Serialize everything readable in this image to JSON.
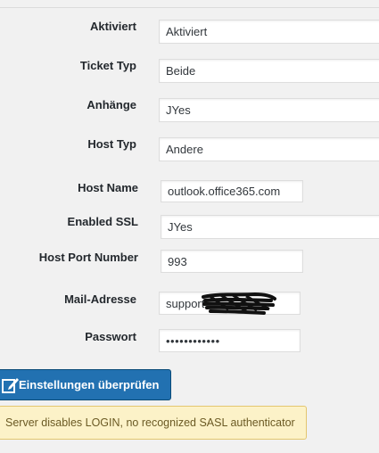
{
  "form": {
    "rows": [
      {
        "label": "Aktiviert",
        "value": "Aktiviert"
      },
      {
        "label": "Ticket Typ",
        "value": "Beide"
      },
      {
        "label": "Anhänge",
        "value": "JYes"
      },
      {
        "label": "Host Typ",
        "value": "Andere"
      },
      {
        "label": "Host Name",
        "value": "outlook.office365.com"
      },
      {
        "label": "Enabled SSL",
        "value": "JYes"
      },
      {
        "label": "Host Port Number",
        "value": "993"
      },
      {
        "label": "Mail-Adresse",
        "value": "support"
      },
      {
        "label": "Passwort",
        "value": "••••••••••••"
      }
    ]
  },
  "actions": {
    "check_settings_label": "Einstellungen überprüfen",
    "check_settings_icon": "edit-icon"
  },
  "notice": {
    "message": "Server disables LOGIN, no recognized SASL authenticator",
    "color": "#fcf2c8"
  },
  "colors": {
    "primary": "#2271b1",
    "background": "#f1f1f1"
  }
}
